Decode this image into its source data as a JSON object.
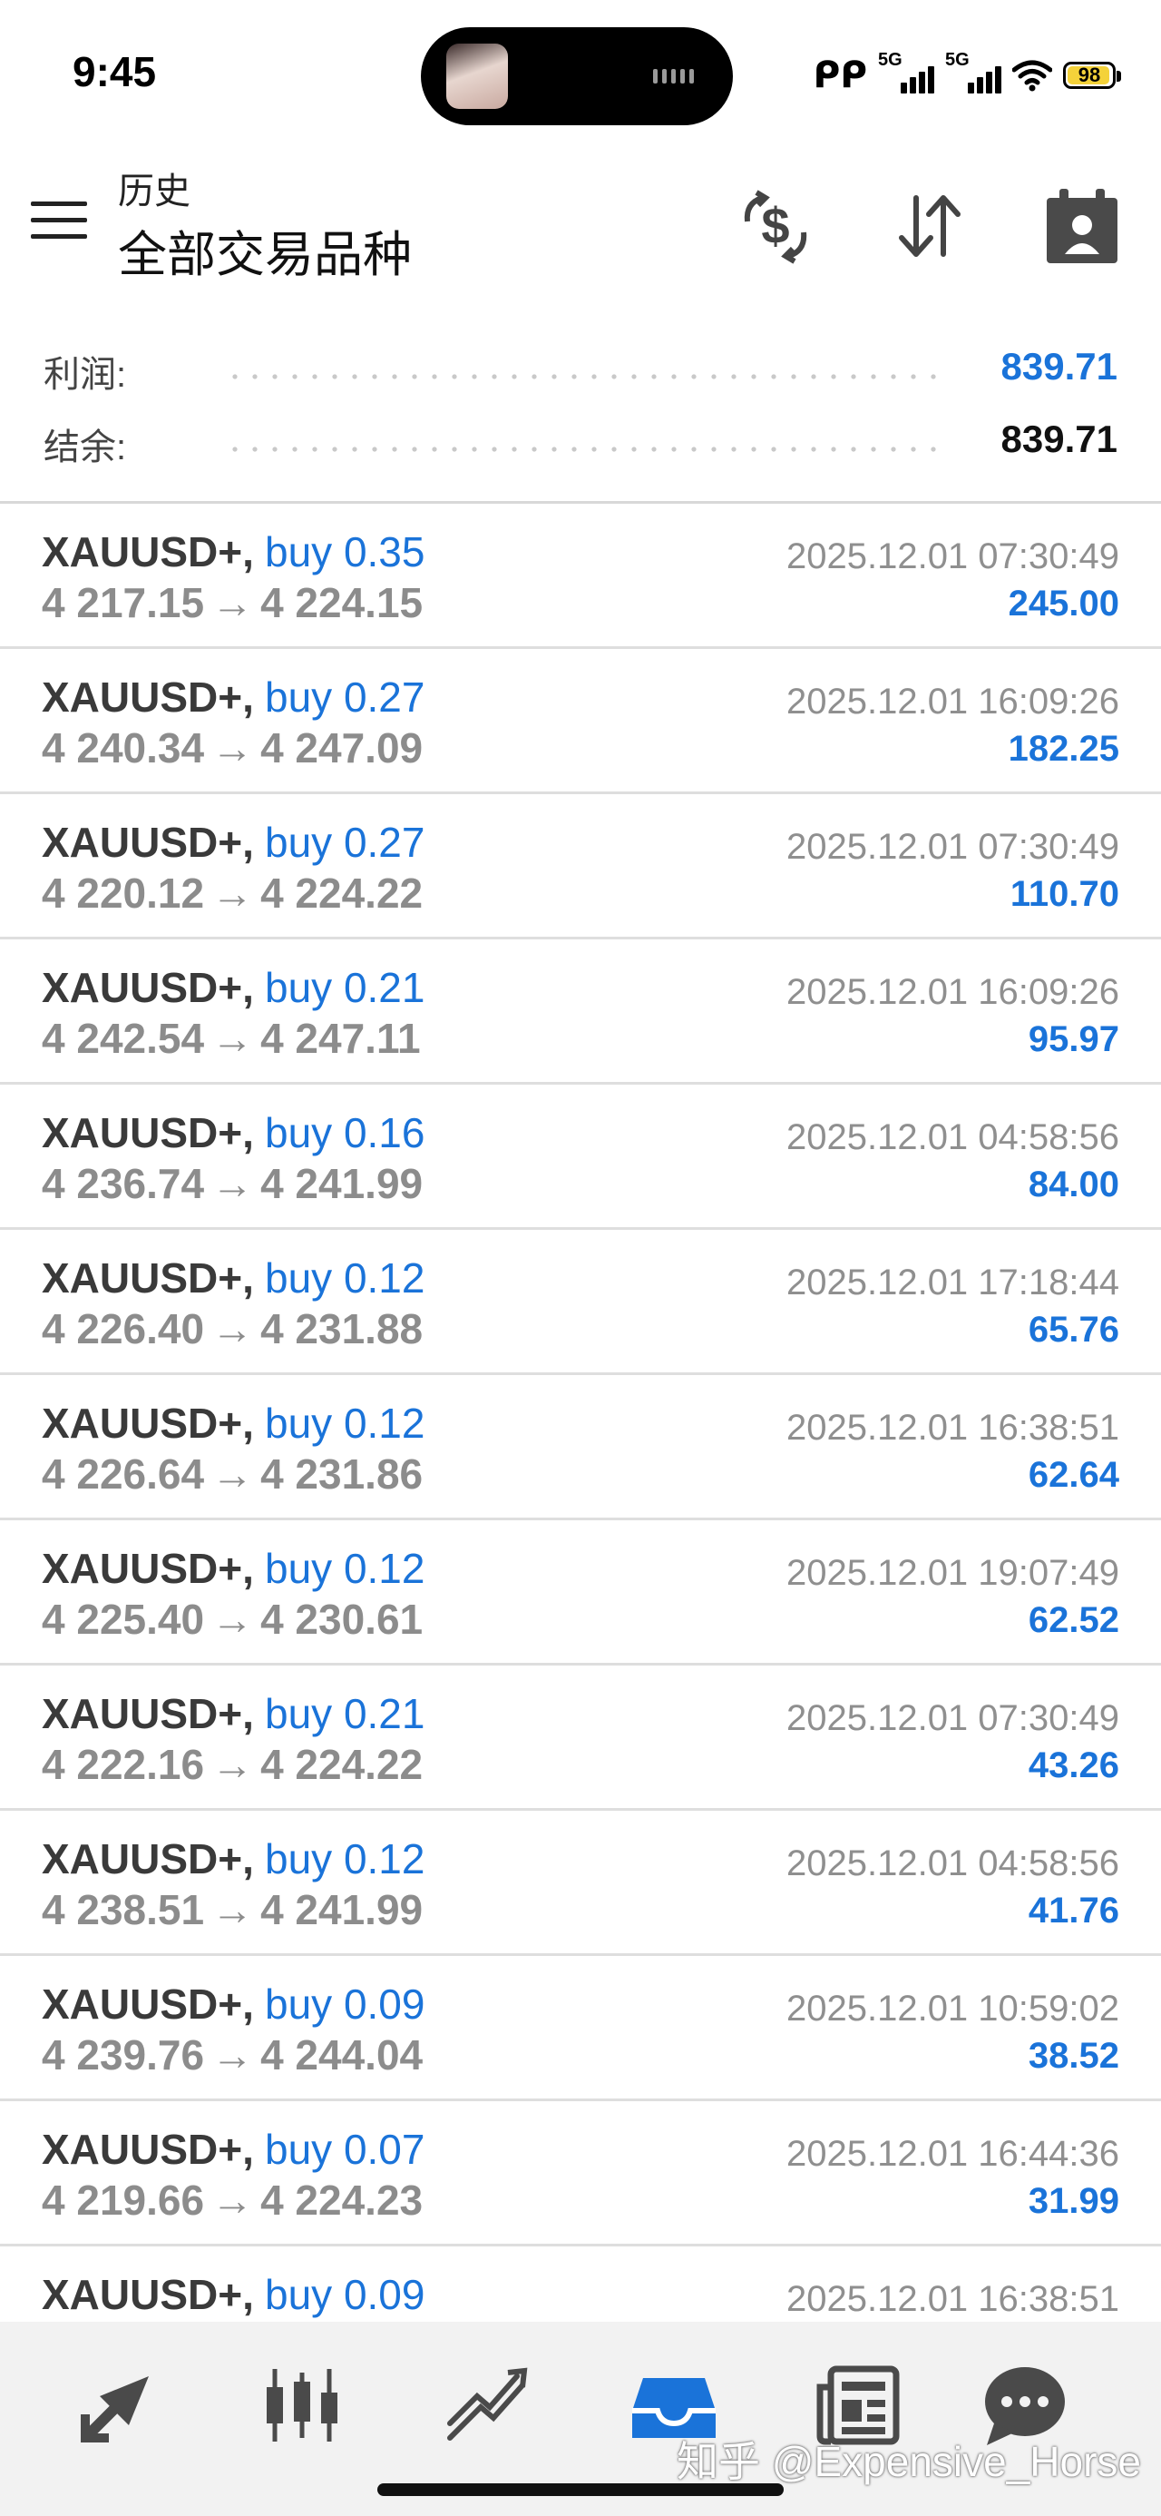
{
  "status_bar": {
    "time": "9:45",
    "network_1": "5G",
    "network_2": "5G",
    "battery": "98"
  },
  "header": {
    "subtitle": "历史",
    "title": "全部交易品种",
    "icons": [
      "menu-icon",
      "currency-exchange-icon",
      "sort-icon",
      "calendar-icon"
    ]
  },
  "summary": {
    "profit_label": "利润:",
    "profit_value": "839.71",
    "balance_label": "结余:",
    "balance_value": "839.71",
    "profit_color": "#1a73d9"
  },
  "trades": [
    {
      "symbol": "XAUUSD+,",
      "side": "buy 0.35",
      "open": "4 217.15",
      "close": "4 224.15",
      "time": "2025.12.01 07:30:49",
      "profit": "245.00"
    },
    {
      "symbol": "XAUUSD+,",
      "side": "buy 0.27",
      "open": "4 240.34",
      "close": "4 247.09",
      "time": "2025.12.01 16:09:26",
      "profit": "182.25"
    },
    {
      "symbol": "XAUUSD+,",
      "side": "buy 0.27",
      "open": "4 220.12",
      "close": "4 224.22",
      "time": "2025.12.01 07:30:49",
      "profit": "110.70"
    },
    {
      "symbol": "XAUUSD+,",
      "side": "buy 0.21",
      "open": "4 242.54",
      "close": "4 247.11",
      "time": "2025.12.01 16:09:26",
      "profit": "95.97"
    },
    {
      "symbol": "XAUUSD+,",
      "side": "buy 0.16",
      "open": "4 236.74",
      "close": "4 241.99",
      "time": "2025.12.01 04:58:56",
      "profit": "84.00"
    },
    {
      "symbol": "XAUUSD+,",
      "side": "buy 0.12",
      "open": "4 226.40",
      "close": "4 231.88",
      "time": "2025.12.01 17:18:44",
      "profit": "65.76"
    },
    {
      "symbol": "XAUUSD+,",
      "side": "buy 0.12",
      "open": "4 226.64",
      "close": "4 231.86",
      "time": "2025.12.01 16:38:51",
      "profit": "62.64"
    },
    {
      "symbol": "XAUUSD+,",
      "side": "buy 0.12",
      "open": "4 225.40",
      "close": "4 230.61",
      "time": "2025.12.01 19:07:49",
      "profit": "62.52"
    },
    {
      "symbol": "XAUUSD+,",
      "side": "buy 0.21",
      "open": "4 222.16",
      "close": "4 224.22",
      "time": "2025.12.01 07:30:49",
      "profit": "43.26"
    },
    {
      "symbol": "XAUUSD+,",
      "side": "buy 0.12",
      "open": "4 238.51",
      "close": "4 241.99",
      "time": "2025.12.01 04:58:56",
      "profit": "41.76"
    },
    {
      "symbol": "XAUUSD+,",
      "side": "buy 0.09",
      "open": "4 239.76",
      "close": "4 244.04",
      "time": "2025.12.01 10:59:02",
      "profit": "38.52"
    },
    {
      "symbol": "XAUUSD+,",
      "side": "buy 0.07",
      "open": "4 219.66",
      "close": "4 224.23",
      "time": "2025.12.01 16:44:36",
      "profit": "31.99"
    },
    {
      "symbol": "XAUUSD+,",
      "side": "buy 0.09",
      "open": "",
      "close": "",
      "time": "2025.12.01 16:38:51",
      "profit": ""
    }
  ],
  "arrow": "→",
  "tab_bar": {
    "tabs": [
      "quotes-icon",
      "chart-icon",
      "trade-icon",
      "history-icon",
      "news-icon",
      "messages-icon"
    ],
    "active_tab": "history-icon",
    "active_color": "#1a73d9",
    "watermark": "知乎 @Expensive_Horse"
  }
}
